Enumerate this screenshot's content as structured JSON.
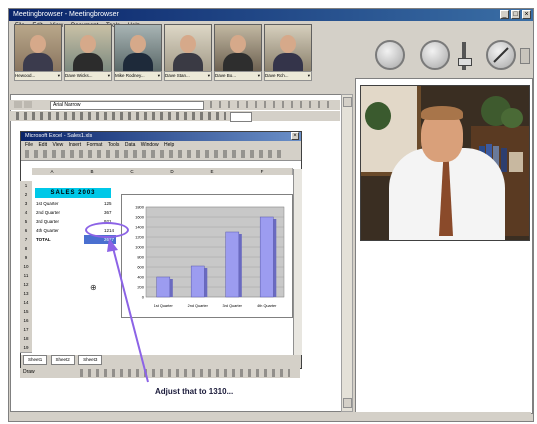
{
  "app": {
    "title": "Meetingbrowser - Meetingbrowser",
    "menu": [
      "File",
      "Edit",
      "View",
      "Document",
      "Tools",
      "Help"
    ],
    "participants": [
      {
        "name": "Hewood..."
      },
      {
        "name": "Dave Wicks..."
      },
      {
        "name": "Mike Rodney..."
      },
      {
        "name": "Dave Stan..."
      },
      {
        "name": "Dave Bo..."
      },
      {
        "name": "Dave Rch..."
      }
    ],
    "font_name": "Arial Narrow"
  },
  "excel": {
    "title": "Microsoft Excel - Sales1.xls",
    "menu": [
      "File",
      "Edit",
      "View",
      "Insert",
      "Format",
      "Tools",
      "Data",
      "Window",
      "Help"
    ],
    "banner": "SALES 2003",
    "rows": [
      {
        "label": "1st Quarter",
        "value": "125"
      },
      {
        "label": "2nd Quarter",
        "value": "367"
      },
      {
        "label": "3rd Quarter",
        "value": "921"
      },
      {
        "label": "4th Quarter",
        "value": "1214"
      },
      {
        "label": "TOTAL",
        "value": "2627"
      }
    ],
    "sheet_tabs": [
      "Sheet1",
      "Sheet2",
      "Sheet3"
    ],
    "draw_label": "Draw"
  },
  "chart_data": {
    "type": "bar",
    "title": "",
    "categories": [
      "1st Quarter",
      "2nd Quarter",
      "3rd Quarter",
      "4th Quarter"
    ],
    "values": [
      400,
      620,
      1300,
      1600
    ],
    "ylim": [
      0,
      1800
    ],
    "yticks": [
      0,
      200,
      400,
      600,
      800,
      1000,
      1200,
      1400,
      1600,
      1800
    ],
    "bar_color": "#9c9cf0"
  },
  "annotation": {
    "text": "Adjust that to 1310..."
  },
  "colors": {
    "titlebar": "#0a246a",
    "highlight": "#8c63e6",
    "banner": "#00c8e8"
  }
}
